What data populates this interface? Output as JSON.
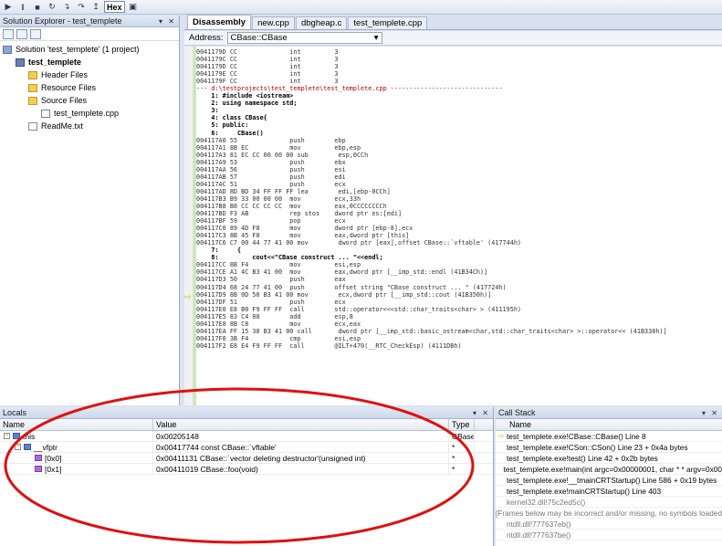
{
  "toolbar": {
    "hex_label": "Hex",
    "icons": [
      "play-icon",
      "pause-icon",
      "stop-icon",
      "restart-icon",
      "step-into-icon",
      "step-over-icon",
      "step-out-icon",
      "breakpoints-icon"
    ]
  },
  "solution_explorer": {
    "title": "Solution Explorer - test_templete",
    "pin_controls": "▾ ✕",
    "items": [
      {
        "label": "Solution 'test_templete' (1 project)",
        "depth": 0,
        "icon": "solution-icon"
      },
      {
        "label": "test_templete",
        "depth": 1,
        "icon": "project-icon"
      },
      {
        "label": "Header Files",
        "depth": 2,
        "icon": "folder-icon"
      },
      {
        "label": "Resource Files",
        "depth": 2,
        "icon": "folder-icon"
      },
      {
        "label": "Source Files",
        "depth": 2,
        "icon": "folder-icon"
      },
      {
        "label": "test_templete.cpp",
        "depth": 3,
        "icon": "cpp-file-icon"
      },
      {
        "label": "ReadMe.txt",
        "depth": 2,
        "icon": "text-file-icon"
      }
    ]
  },
  "tabs": [
    {
      "label": "Disassembly",
      "active": true
    },
    {
      "label": "new.cpp",
      "active": false
    },
    {
      "label": "dbgheap.c",
      "active": false
    },
    {
      "label": "test_templete.cpp",
      "active": false
    }
  ],
  "address": {
    "label": "Address:",
    "value": "CBase::CBase"
  },
  "disassembly": [
    {
      "text": "0041179D CC              int         3",
      "kind": "asm"
    },
    {
      "text": "0041179C CC              int         3",
      "kind": "asm"
    },
    {
      "text": "0041179D CC              int         3",
      "kind": "asm"
    },
    {
      "text": "0041179E CC              int         3",
      "kind": "asm"
    },
    {
      "text": "0041179F CC              int         3",
      "kind": "asm"
    },
    {
      "text": "--- d:\\testprojects\\test_templete\\test_templete.cpp ------------------------------",
      "kind": "hdr"
    },
    {
      "text": "    1: #include <iostream>",
      "kind": "src"
    },
    {
      "text": "    2: using namespace std;",
      "kind": "src"
    },
    {
      "text": "    3:",
      "kind": "src"
    },
    {
      "text": "    4: class CBase{",
      "kind": "src"
    },
    {
      "text": "    5: public:",
      "kind": "src"
    },
    {
      "text": "    6:     CBase()",
      "kind": "src"
    },
    {
      "text": "004117A0 55              push        ebp",
      "kind": "asm"
    },
    {
      "text": "004117A1 8B EC           mov         ebp,esp",
      "kind": "asm"
    },
    {
      "text": "004117A3 81 EC CC 00 00 00 sub        esp,0CCh",
      "kind": "asm"
    },
    {
      "text": "004117A9 53              push        ebx",
      "kind": "asm"
    },
    {
      "text": "004117AA 56              push        esi",
      "kind": "asm"
    },
    {
      "text": "004117AB 57              push        edi",
      "kind": "asm"
    },
    {
      "text": "004117AC 51              push        ecx",
      "kind": "asm"
    },
    {
      "text": "004117AD 8D BD 34 FF FF FF lea        edi,[ebp-0CCh]",
      "kind": "asm"
    },
    {
      "text": "004117B3 B9 33 00 00 00  mov         ecx,33h",
      "kind": "asm"
    },
    {
      "text": "004117B8 B8 CC CC CC CC  mov         eax,0CCCCCCCCh",
      "kind": "asm"
    },
    {
      "text": "004117BD F3 AB           rep stos    dword ptr es:[edi]",
      "kind": "asm"
    },
    {
      "text": "004117BF 59              pop         ecx",
      "kind": "asm"
    },
    {
      "text": "004117C0 89 4D F8        mov         dword ptr [ebp-8],ecx",
      "kind": "asm"
    },
    {
      "text": "004117C3 8B 45 F8        mov         eax,dword ptr [this]",
      "kind": "asm"
    },
    {
      "text": "004117C6 C7 00 44 77 41 00 mov        dword ptr [eax],offset CBase::`vftable' (417744h)",
      "kind": "asm"
    },
    {
      "text": "    7:     {",
      "kind": "src"
    },
    {
      "text": "    8:         cout<<\"CBase construct ... \"<<endl;",
      "kind": "src"
    },
    {
      "text": "004117CC 8B F4           mov         esi,esp",
      "kind": "asm"
    },
    {
      "text": "004117CE A1 4C B3 41 00  mov         eax,dword ptr [__imp_std::endl (41B34Ch)]",
      "kind": "asm"
    },
    {
      "text": "004117D3 50              push        eax",
      "kind": "asm"
    },
    {
      "text": "004117D4 68 24 77 41 00  push        offset string \"CBase construct ... \" (417724h)",
      "kind": "asm"
    },
    {
      "text": "004117D9 8B 0D 50 B3 41 00 mov        ecx,dword ptr [__imp_std::cout (41B350h)]",
      "kind": "asm"
    },
    {
      "text": "004117DF 51              push        ecx",
      "kind": "asm"
    },
    {
      "text": "004117E0 E8 B0 F9 FF FF  call        std::operator<<<std::char_traits<char> > (411195h)",
      "kind": "asm"
    },
    {
      "text": "004117E5 83 C4 08        add         esp,8",
      "kind": "asm"
    },
    {
      "text": "004117E8 8B C8           mov         ecx,eax",
      "kind": "asm"
    },
    {
      "text": "004117EA FF 15 38 B3 41 00 call       dword ptr [__imp_std::basic_ostream<char,std::char_traits<char> >::operator<< (41B338h)]",
      "kind": "asm"
    },
    {
      "text": "004117F0 3B F4           cmp         esi,esp",
      "kind": "asm"
    },
    {
      "text": "004117F2 E8 E4 F9 FF FF  call        @ILT+470(__RTC_CheckEsp) (4111DBh)",
      "kind": "asm"
    }
  ],
  "locals": {
    "title": "Locals",
    "pin_controls": "▾ ✕",
    "columns": [
      "Name",
      "Value",
      "Type"
    ],
    "rows": [
      {
        "name": "this",
        "value": "0x00205148",
        "type": "CBase * c",
        "indent": 0,
        "expander": "−",
        "icon": "variable-icon"
      },
      {
        "name": "__vfptr",
        "value": "0x00417744 const CBase::`vftable'",
        "type": "*",
        "indent": 1,
        "expander": "−",
        "icon": "variable-icon"
      },
      {
        "name": "[0x0]",
        "value": "0x00411131 CBase::`vector deleting destructor'(unsigned int)",
        "type": "*",
        "indent": 2,
        "expander": "",
        "icon": "method-icon"
      },
      {
        "name": "[0x1]",
        "value": "0x00411019 CBase::foo(void)",
        "type": "*",
        "indent": 2,
        "expander": "",
        "icon": "method-icon"
      }
    ]
  },
  "call_stack": {
    "title": "Call Stack",
    "pin_controls": "▾ ✕",
    "column": "Name",
    "rows": [
      {
        "label": "test_templete.exe!CBase::CBase()  Line 8",
        "current": true,
        "dim": false
      },
      {
        "label": "test_templete.exe!CSon::CSon()  Line 23 + 0x4a bytes",
        "current": false,
        "dim": false
      },
      {
        "label": "test_templete.exe!test()  Line 42 + 0x2b bytes",
        "current": false,
        "dim": false
      },
      {
        "label": "test_templete.exe!main(int argc=0x00000001, char * * argv=0x00",
        "current": false,
        "dim": false
      },
      {
        "label": "test_templete.exe!__tmainCRTStartup()  Line 586 + 0x19 bytes",
        "current": false,
        "dim": false
      },
      {
        "label": "test_templete.exe!mainCRTStartup()  Line 403",
        "current": false,
        "dim": false
      },
      {
        "label": "kernel32.dll!75c2ed5c()",
        "current": false,
        "dim": true
      },
      {
        "label": "[Frames below may be incorrect and/or missing, no symbols loaded",
        "current": false,
        "dim": true
      },
      {
        "label": "ntdll.dll!777637eb()",
        "current": false,
        "dim": true
      },
      {
        "label": "ntdll.dll!777637be()",
        "current": false,
        "dim": true
      }
    ]
  },
  "colors": {
    "annotation": "#e01010",
    "accent": "#3b5b99"
  }
}
